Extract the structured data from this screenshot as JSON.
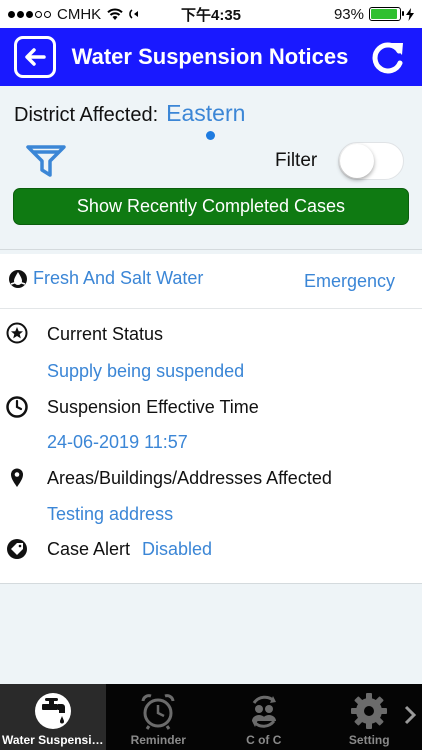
{
  "status_bar": {
    "carrier": "CMHK",
    "time": "下午4:35",
    "battery": "93%",
    "battery_level": 0.93
  },
  "header": {
    "title": "Water Suspension Notices",
    "back_icon": "back-arrow-icon",
    "refresh_icon": "refresh-icon"
  },
  "filter": {
    "district_label": "District Affected:",
    "district_value": "Eastern",
    "filter_label": "Filter",
    "filter_enabled": false,
    "completed_button": "Show Recently Completed Cases"
  },
  "notice": {
    "water_type": "Fresh And Salt Water",
    "urgency": "Emergency",
    "status_label": "Current Status",
    "status_value": "Supply being suspended",
    "time_label": "Suspension Effective Time",
    "time_value": "24-06-2019 11:57",
    "areas_label": "Areas/Buildings/Addresses Affected",
    "areas_value": "Testing address",
    "alert_label": "Case Alert",
    "alert_value": "Disabled"
  },
  "tabs": [
    {
      "label": "Water Suspensi…",
      "icon": "water-tap-icon",
      "active": true
    },
    {
      "label": "Reminder",
      "icon": "alarm-clock-icon",
      "active": false
    },
    {
      "label": "C of C",
      "icon": "people-cycle-icon",
      "active": false
    },
    {
      "label": "Setting",
      "icon": "gear-icon",
      "active": false
    }
  ],
  "colors": {
    "header_bg": "#1919ff",
    "accent_text": "#3b86d6",
    "button_green": "#0f7a12",
    "tabbar_bg": "#050505"
  }
}
